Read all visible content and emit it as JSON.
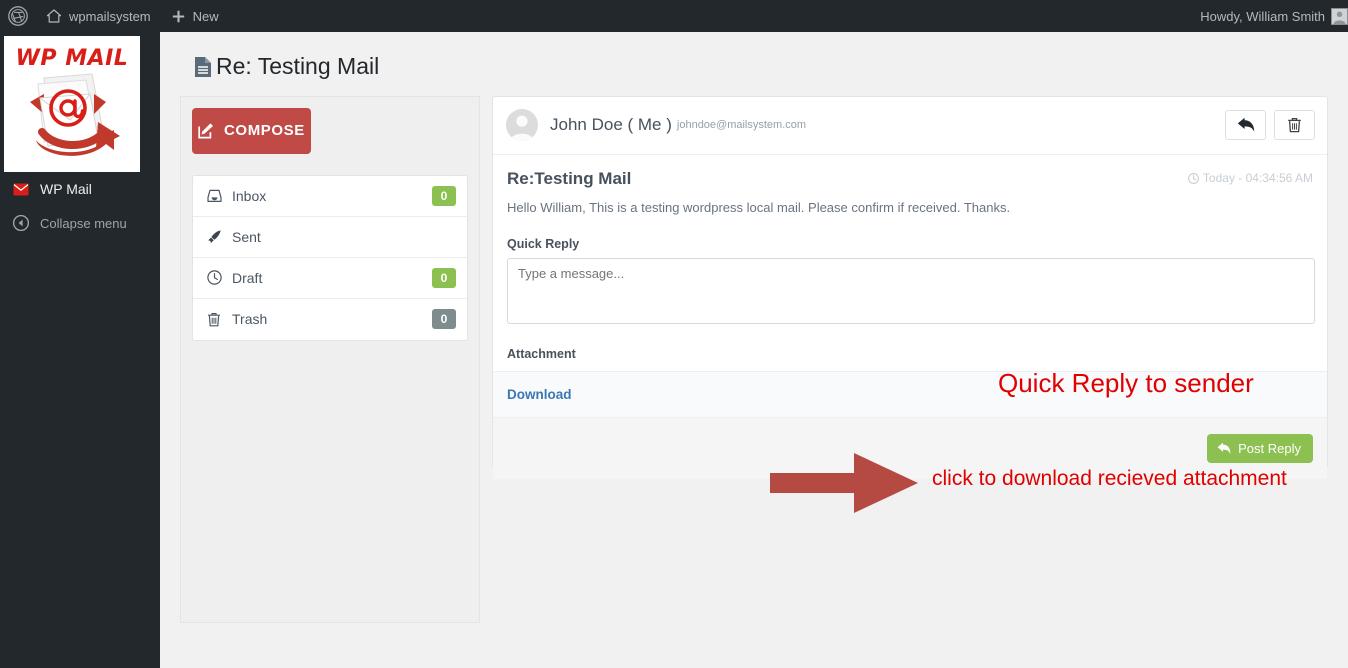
{
  "adminbar": {
    "wp_logo_icon": "wordpress-logo-icon",
    "site_home_icon": "home-icon",
    "site_name": "wpmailsystem",
    "new_icon": "plus-icon",
    "new_label": "New",
    "howdy": "Howdy, William Smith",
    "avatar_icon": "user-avatar-icon"
  },
  "sidebar": {
    "logo": {
      "title": "WP MAIL",
      "alt": "wp-mail-logo"
    },
    "items": [
      {
        "label": "WP Mail",
        "icon": "envelope-icon"
      },
      {
        "label": "Collapse menu",
        "icon": "collapse-arrow-icon"
      }
    ]
  },
  "page": {
    "title": "Re: Testing Mail",
    "title_icon": "file-text-icon"
  },
  "mail_nav": {
    "compose_label": "COMPOSE",
    "compose_icon": "pencil-square-icon",
    "compose_color": "#bf4a46",
    "folders": [
      {
        "label": "Inbox",
        "icon": "inbox-icon",
        "count": "0",
        "badge_color": "#8cc152"
      },
      {
        "label": "Sent",
        "icon": "paper-plane-icon",
        "count": "",
        "badge_color": ""
      },
      {
        "label": "Draft",
        "icon": "clock-icon",
        "count": "0",
        "badge_color": "#8cc152"
      },
      {
        "label": "Trash",
        "icon": "trash-icon",
        "count": "0",
        "badge_color": "#7f8c8d"
      }
    ]
  },
  "mail": {
    "sender_name": "John Doe ( Me )",
    "sender_email": "johndoe@mailsystem.com",
    "sender_avatar_icon": "user-avatar-icon",
    "reply_button_icon": "reply-arrow-icon",
    "delete_button_icon": "trash-icon",
    "subject": "Re:Testing Mail",
    "time_icon": "clock-icon",
    "time": "Today - 04:34:56 AM",
    "body": "Hello William, This is a testing wordpress local mail. Please confirm if received. Thanks.",
    "quick_reply_label": "Quick Reply",
    "quick_reply_value": "",
    "quick_reply_placeholder": "Type a message...",
    "attachment_label": "Attachment",
    "attachment_download_label": "Download",
    "post_reply_label": "Post Reply",
    "post_reply_icon": "reply-arrow-icon",
    "post_reply_color": "#8cc152"
  },
  "annotations": {
    "color": "#e00000",
    "quick_reply": "Quick Reply to sender",
    "download": "click to download recieved attachment",
    "arrow_icon": "right-arrow-annotation"
  }
}
